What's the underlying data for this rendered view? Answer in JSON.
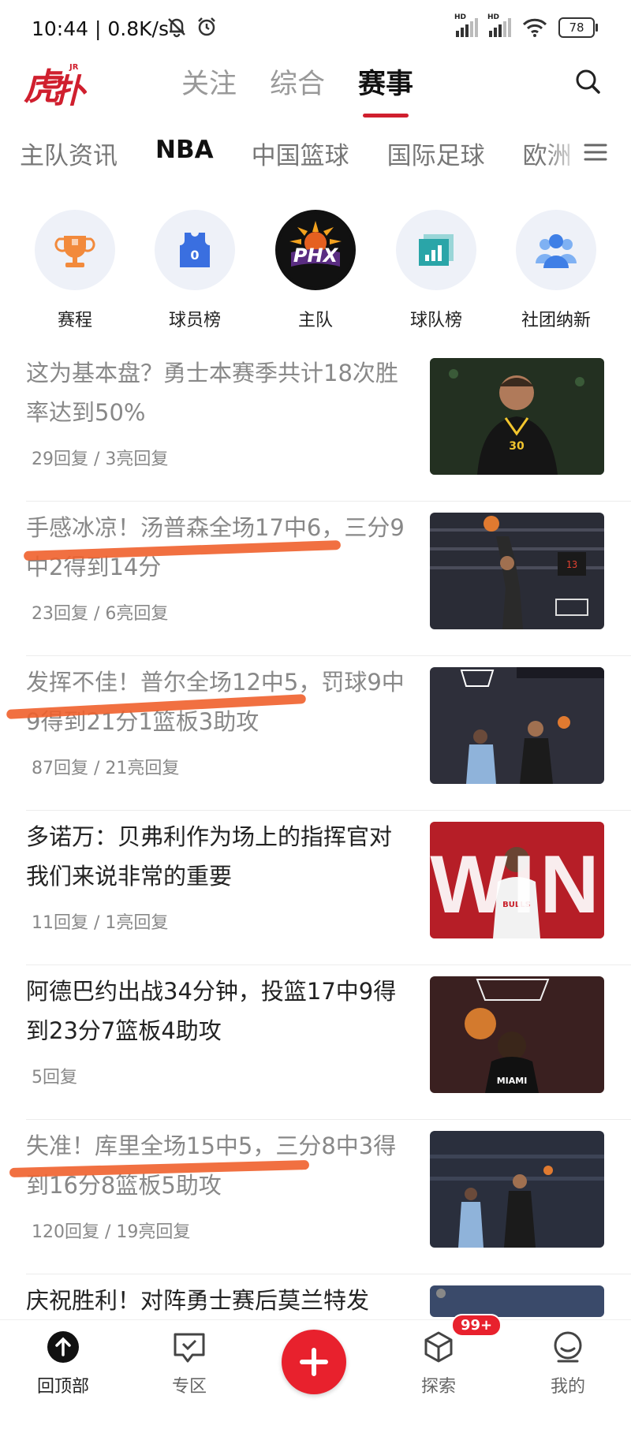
{
  "status": {
    "time": "10:44 | 0.8K/s",
    "battery": "78"
  },
  "header": {
    "logo_text": "虎扑",
    "tabs": [
      "关注",
      "综合",
      "赛事"
    ],
    "active_tab": "赛事"
  },
  "categories": {
    "items": [
      "主队资讯",
      "NBA",
      "中国篮球",
      "国际足球",
      "欧洲"
    ],
    "active": "NBA"
  },
  "quick": {
    "items": [
      {
        "label": "赛程",
        "icon": "trophy-icon"
      },
      {
        "label": "球员榜",
        "icon": "jersey-icon"
      },
      {
        "label": "主队",
        "icon": "phx-suns-logo",
        "logo_text": "PHX"
      },
      {
        "label": "球队榜",
        "icon": "bar-chart-icon"
      },
      {
        "label": "社团纳新",
        "icon": "group-icon"
      }
    ]
  },
  "feed": {
    "items": [
      {
        "title": "这为基本盘？勇士本赛季共计18次胜率达到50%",
        "meta": "29回复 / 3亮回复",
        "read": true
      },
      {
        "title": "手感冰凉！汤普森全场17中6，三分9中2得到14分",
        "meta": "23回复 / 6亮回复",
        "read": true
      },
      {
        "title": "发挥不佳！普尔全场12中5，罚球9中9得到21分1篮板3助攻",
        "meta": "87回复 / 21亮回复",
        "read": true
      },
      {
        "title": "多诺万：贝弗利作为场上的指挥官对我们来说非常的重要",
        "meta": "11回复 / 1亮回复",
        "read": false,
        "thumb_text": "WIN"
      },
      {
        "title": "阿德巴约出战34分钟，投篮17中9得到23分7篮板4助攻",
        "meta": "5回复",
        "read": false
      },
      {
        "title": "失准！库里全场15中5，三分8中3得到16分8篮板5助攻",
        "meta": "120回复 / 19亮回复",
        "read": true
      },
      {
        "title": "庆祝胜利！对阵勇士赛后莫兰特发",
        "meta": "",
        "read": false
      }
    ]
  },
  "bottom_nav": {
    "items": [
      "回顶部",
      "专区",
      "",
      "探索",
      "我的"
    ],
    "badge": "99+"
  },
  "colors": {
    "brand_red": "#d01f2e",
    "annotation_orange": "#f0612c"
  }
}
